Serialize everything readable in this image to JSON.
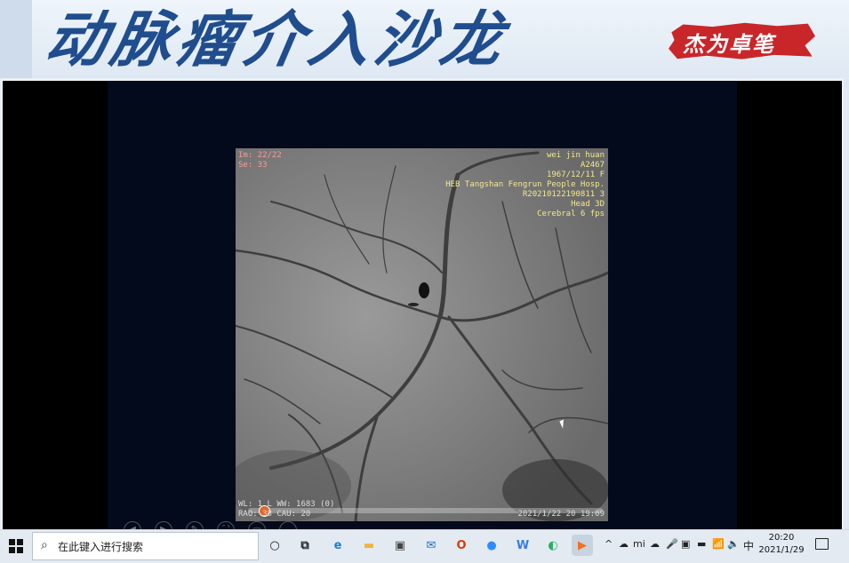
{
  "banner": {
    "title": "动脉瘤介入沙龙",
    "badge": "杰为卓笔"
  },
  "viewer": {
    "overlay_top_left": [
      "Im: 22/22",
      "Se: 33"
    ],
    "overlay_top_right": [
      "wei jin  huan",
      "A2467",
      "1967/12/11 F",
      "HEB Tangshan Fengrun People Hosp.",
      "R20210122190811 3",
      "Head 3D",
      "Cerebral 6 fps"
    ],
    "overlay_bottom_left": [
      "WL: 1 L  WW: 1683 (0)",
      "RAO: 38  CAU: 20"
    ],
    "overlay_bottom_right": "2021/1/22 20 19:09",
    "playback_progress": 0.03
  },
  "controls": [
    "◀",
    "▶",
    "✎",
    "⛶",
    "▭",
    "…"
  ],
  "taskbar": {
    "search_placeholder": "在此键入进行搜索",
    "apps": [
      {
        "name": "cortana-icon",
        "glyph": "○",
        "color": "#222"
      },
      {
        "name": "task-view-icon",
        "glyph": "⧉",
        "color": "#222"
      },
      {
        "name": "edge-icon",
        "glyph": "e",
        "color": "#1a7fd4"
      },
      {
        "name": "file-explorer-icon",
        "glyph": "▬",
        "color": "#f0b53a"
      },
      {
        "name": "store-icon",
        "glyph": "▣",
        "color": "#444"
      },
      {
        "name": "mail-icon",
        "glyph": "✉",
        "color": "#1b6fd0"
      },
      {
        "name": "office-icon",
        "glyph": "O",
        "color": "#d83b01"
      },
      {
        "name": "zoom-icon",
        "glyph": "●",
        "color": "#2d8cff"
      },
      {
        "name": "wps-icon",
        "glyph": "W",
        "color": "#3a7de0"
      },
      {
        "name": "wechat-icon",
        "glyph": "◐",
        "color": "#2aae67"
      },
      {
        "name": "media-player-icon",
        "glyph": "▶",
        "color": "#f36f21"
      }
    ],
    "tray": [
      "^",
      "☁",
      "mi",
      "☁",
      "🎤",
      "▣",
      "▬",
      "📶",
      "🔈"
    ],
    "ime": "中",
    "time": "20:20",
    "date": "2021/1/29"
  }
}
